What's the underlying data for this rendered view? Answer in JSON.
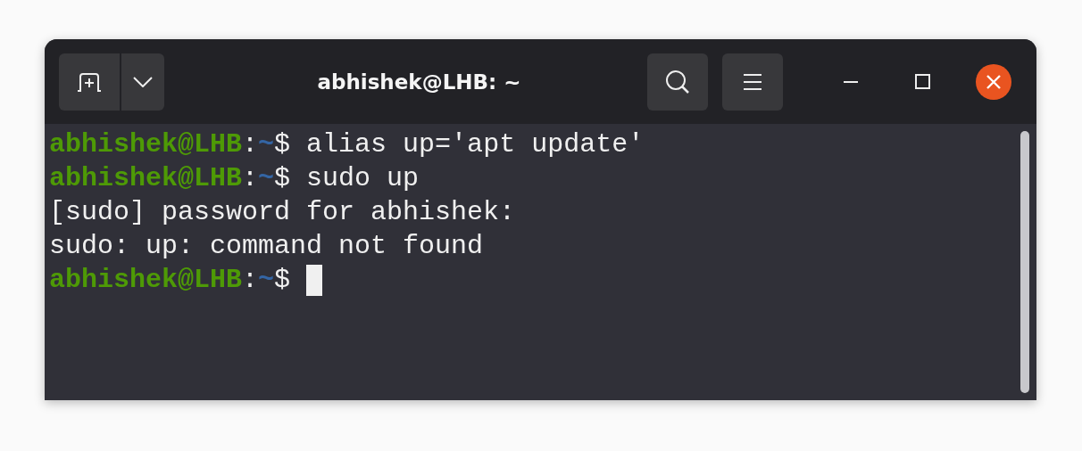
{
  "window": {
    "title": "abhishek@LHB: ~"
  },
  "terminal": {
    "lines": [
      {
        "kind": "prompt",
        "user": "abhishek@LHB",
        "sep": ":",
        "path": "~",
        "sign": "$",
        "command": "alias up='apt update'",
        "cursor": false
      },
      {
        "kind": "prompt",
        "user": "abhishek@LHB",
        "sep": ":",
        "path": "~",
        "sign": "$",
        "command": "sudo up",
        "cursor": false
      },
      {
        "kind": "output",
        "text": "[sudo] password for abhishek:"
      },
      {
        "kind": "output",
        "text": "sudo: up: command not found"
      },
      {
        "kind": "prompt",
        "user": "abhishek@LHB",
        "sep": ":",
        "path": "~",
        "sign": "$",
        "cursor": true
      }
    ]
  }
}
